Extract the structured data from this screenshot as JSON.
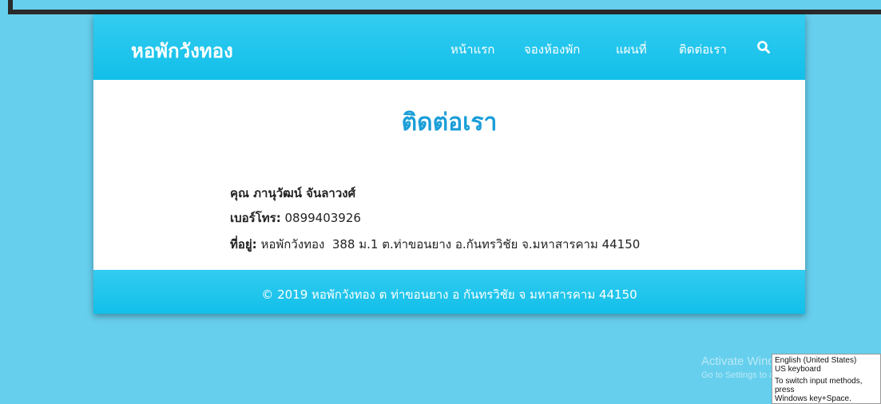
{
  "brand": "หอพักวังทอง",
  "nav": {
    "items": [
      {
        "label": "หน้าแรก"
      },
      {
        "label": "จองห้องพัก"
      },
      {
        "label": "แผนที่"
      },
      {
        "label": "ติดต่อเรา"
      }
    ],
    "search_icon": "search-icon"
  },
  "page": {
    "title": "ติดต่อเรา",
    "contact_name": "คุณ ภานุวัฒน์ จันลาวงศ์",
    "phone_label": "เบอร์โทร:",
    "phone_value": "0899403926",
    "address_label": "ที่อยู่:",
    "address_value": "หอพักวังทอง  388 ม.1 ต.ท่าขอนยาง อ.กันทรวิชัย จ.มหาสารคาม 44150"
  },
  "footer": {
    "text": "© 2019 หอพักวังทอง ต ท่าขอนยาง อ กันทรวิชัย จ มหาสารคาม 44150"
  },
  "os_overlay": {
    "watermark_title": "Activate Windows",
    "watermark_sub": "Go to Settings to activate Windows.",
    "ime_line1": "English (United States)",
    "ime_line2": "US keyboard",
    "ime_line3": "To switch input methods, press",
    "ime_line4": "Windows key+Space."
  },
  "colors": {
    "page_background": "#66cfed",
    "navbar": "#12bfe9",
    "title": "#1a9ed8",
    "text": "#222222"
  }
}
